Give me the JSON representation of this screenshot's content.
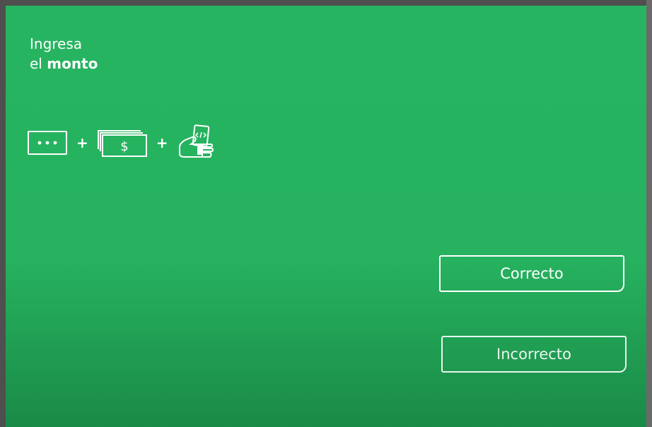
{
  "prompt": {
    "line1": "Ingresa",
    "line2_prefix": "el",
    "line2_bold": "monto"
  },
  "steps": {
    "icons": [
      "pin-dots-icon",
      "cash-bills-icon",
      "hand-holding-receipt-icon"
    ],
    "separator": "+"
  },
  "buttons": {
    "correct_label": "Correcto",
    "incorrect_label": "Incorrecto"
  },
  "colors": {
    "screen_green": "#27b461",
    "foreground": "#ffffff"
  }
}
